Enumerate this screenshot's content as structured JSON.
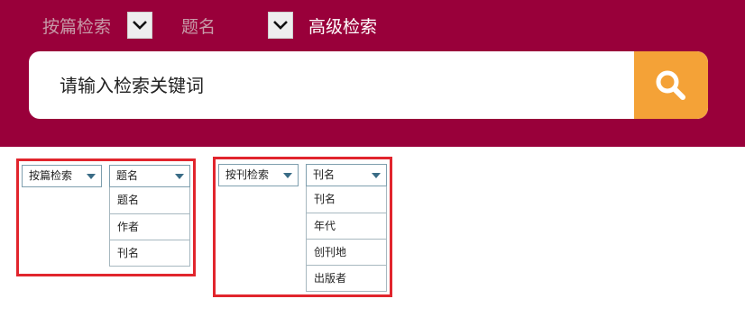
{
  "header": {
    "filter1_label": "按篇检索",
    "filter2_label": "题名",
    "advanced_label": "高级检索"
  },
  "search": {
    "placeholder": "请输入检索关键词"
  },
  "colors": {
    "header_bg": "#99003a",
    "search_button": "#f4a237",
    "frame_border": "#e1252d"
  },
  "panel_article": {
    "mode_select": "按篇检索",
    "field_select": "题名",
    "options": [
      "题名",
      "作者",
      "刊名"
    ]
  },
  "panel_journal": {
    "mode_select": "按刊检索",
    "field_select": "刊名",
    "options": [
      "刊名",
      "年代",
      "创刊地",
      "出版者"
    ]
  }
}
